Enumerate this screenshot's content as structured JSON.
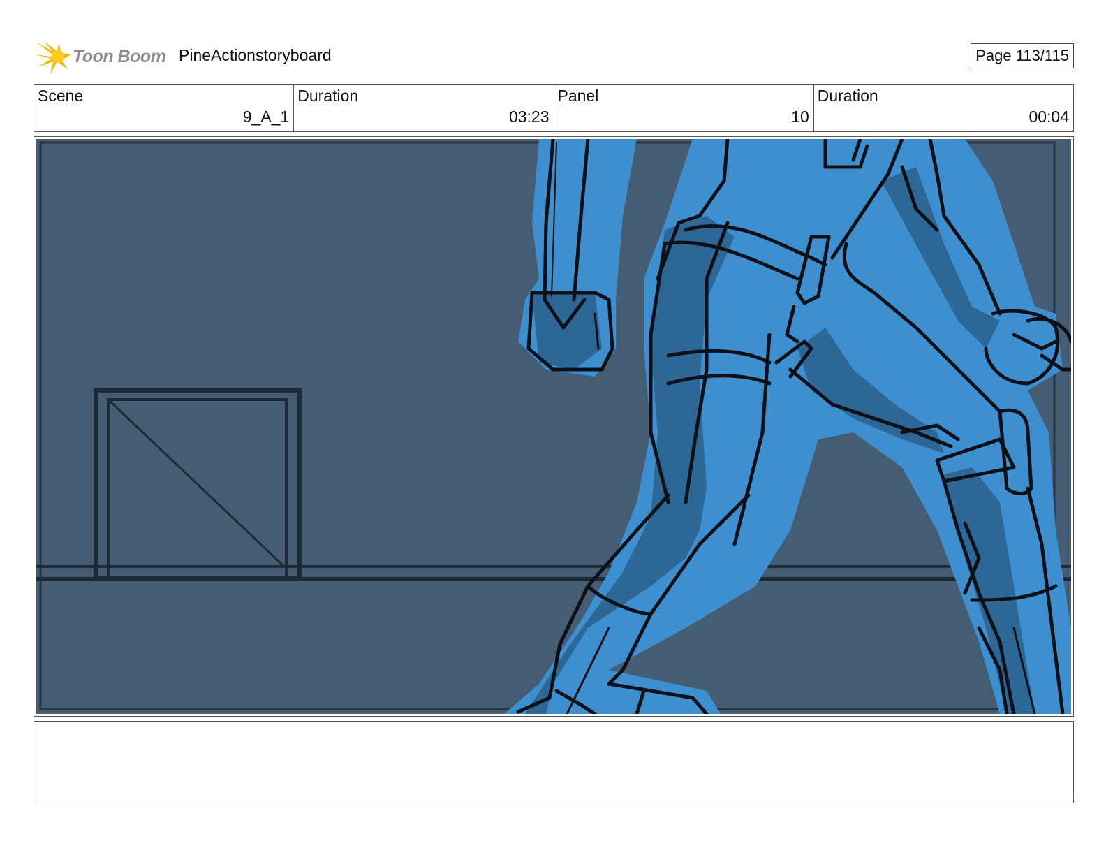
{
  "header": {
    "logo_text": "Toon Boom",
    "project_title": "PineActionstoryboard",
    "page_label": "Page 113/115"
  },
  "info": [
    {
      "label": "Scene",
      "value": "9_A_1"
    },
    {
      "label": "Duration",
      "value": "03:23"
    },
    {
      "label": "Panel",
      "value": "10"
    },
    {
      "label": "Duration",
      "value": "00:04"
    }
  ],
  "colors": {
    "background": "#455d72",
    "figure_fill": "#3e8fd0",
    "figure_shadow": "#2d6796",
    "ink": "#0d1117",
    "logo_star": "#f5b400"
  },
  "notes": ""
}
